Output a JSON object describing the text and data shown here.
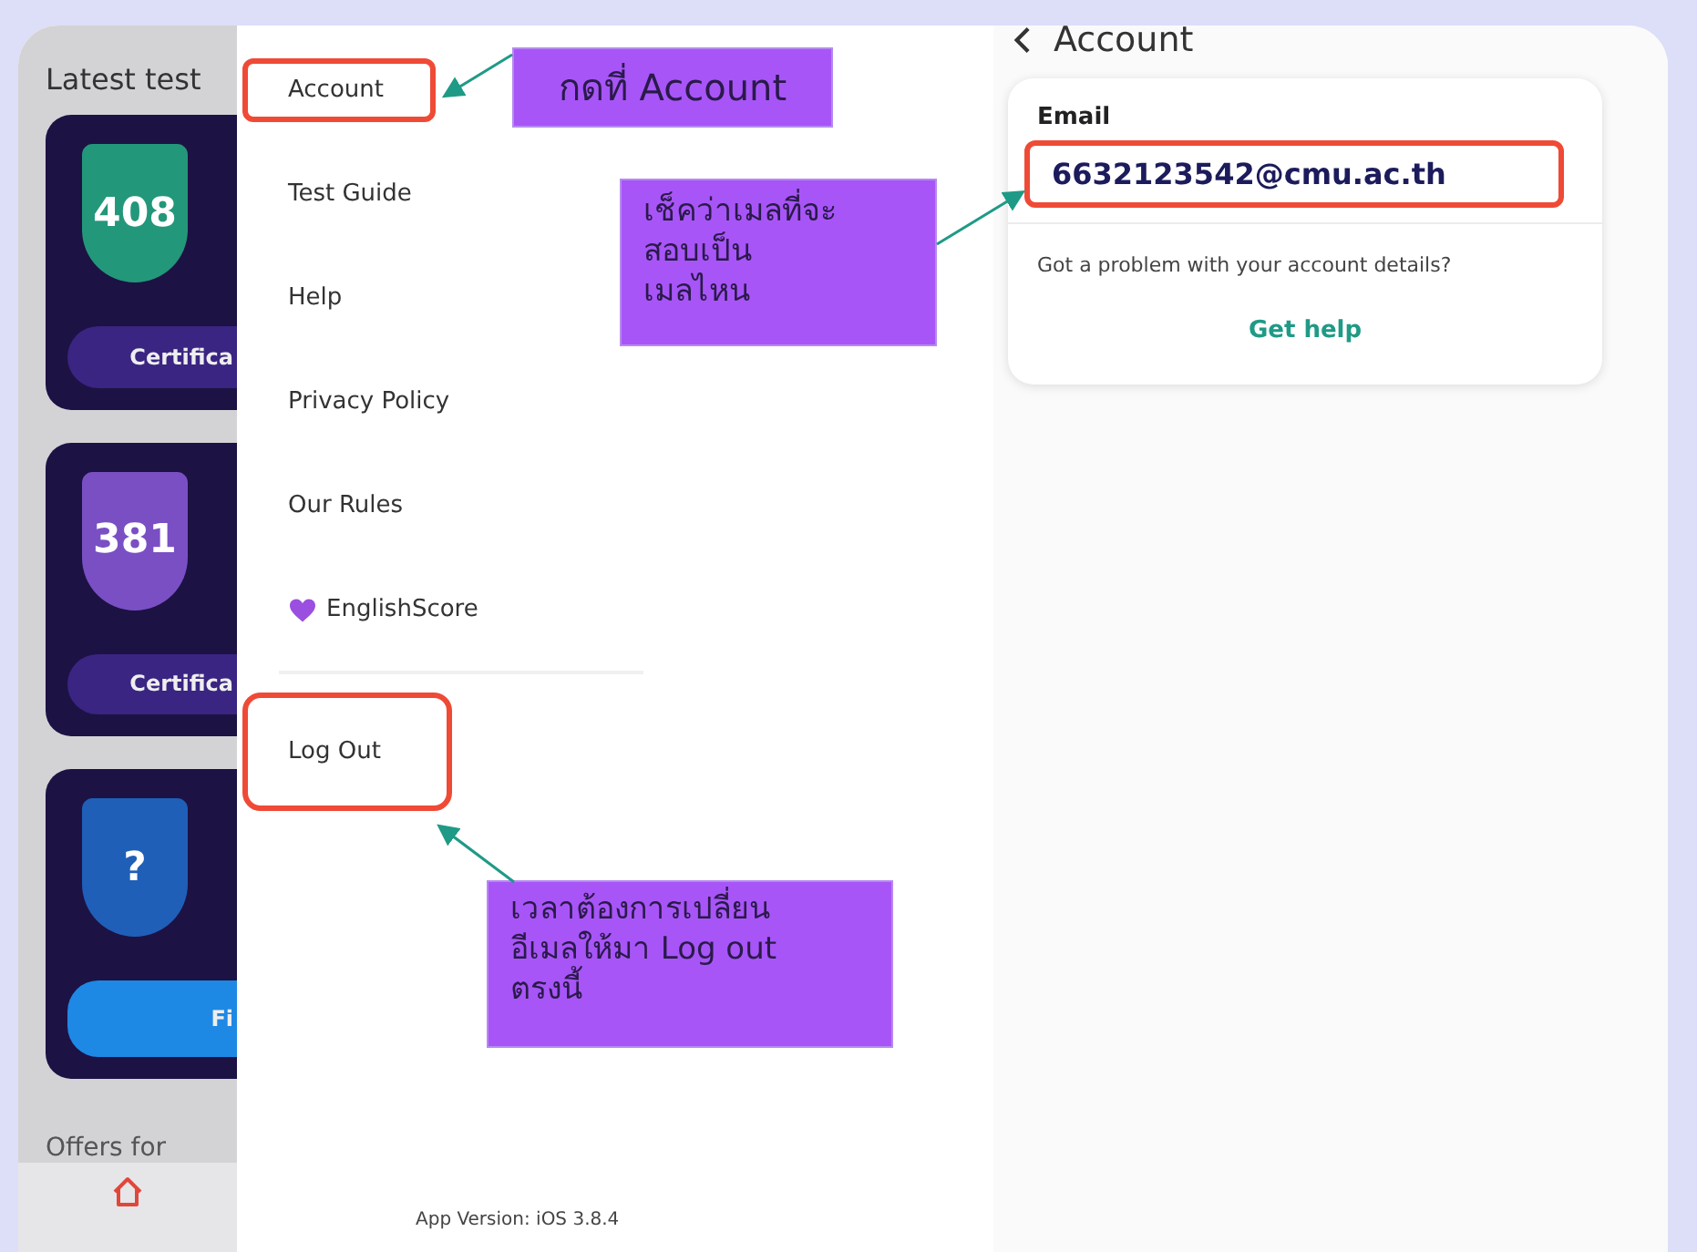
{
  "background_app": {
    "heading": "Latest test",
    "cards": [
      {
        "score": "408",
        "color": "#23977a",
        "kind": "certificate",
        "button_label": "Certifica"
      },
      {
        "score": "381",
        "color": "#7a4fc4",
        "kind": "certificate",
        "button_label": "Certifica"
      },
      {
        "score": "?",
        "color": "#1f5fb8",
        "kind": "start",
        "button_label": "Fi"
      }
    ],
    "offers_heading": "Offers for"
  },
  "menu": {
    "items": [
      {
        "label": "Account",
        "highlighted": true,
        "kind": "text"
      },
      {
        "label": "Test Guide",
        "highlighted": false,
        "kind": "text"
      },
      {
        "label": "Help",
        "highlighted": false,
        "kind": "text"
      },
      {
        "label": "Privacy Policy",
        "highlighted": false,
        "kind": "text"
      },
      {
        "label": "Our Rules",
        "highlighted": false,
        "kind": "text"
      },
      {
        "label": "EnglishScore",
        "highlighted": false,
        "kind": "brand"
      }
    ],
    "logout": {
      "label": "Log Out",
      "highlighted": true
    },
    "app_version": "App Version: iOS 3.8.4"
  },
  "account": {
    "title": "Account",
    "email_label": "Email",
    "email": "6632123542@cmu.ac.th",
    "email_highlighted": true,
    "problem_text": "Got a problem with your account details?",
    "help_link": "Get help"
  },
  "annotations": [
    {
      "text": "กดที่ Account"
    },
    {
      "text": "เช็คว่าเมลที่จะ\nสอบเป็น\nเมลไหน"
    },
    {
      "text": "เวลาต้องการเปลี่ยน\nอีเมลให้มา Log out\nตรงนี้"
    }
  ]
}
